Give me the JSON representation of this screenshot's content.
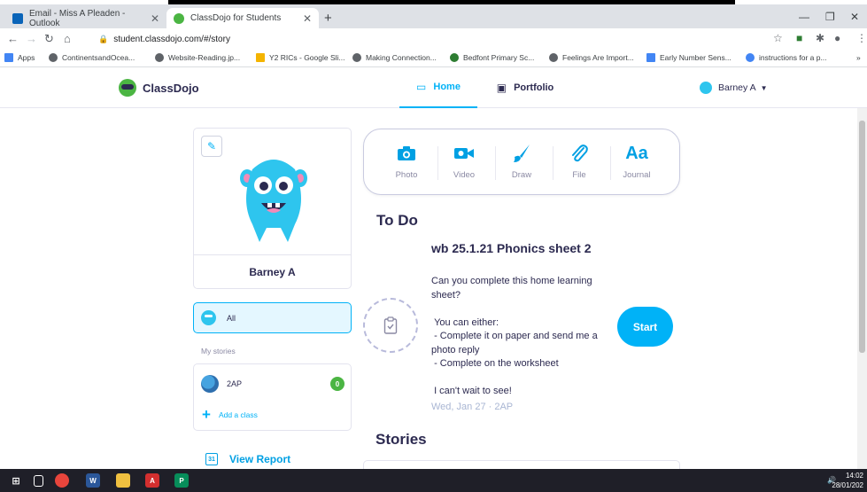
{
  "browser": {
    "tabs": [
      {
        "title": "Email - Miss A Pleaden - Outlook",
        "color": "#0a64b8"
      },
      {
        "title": "ClassDojo for Students",
        "color": "#4bb543"
      }
    ],
    "url": "student.classdojo.com/#/story",
    "bookmarks": [
      {
        "label": "Apps",
        "color": "#4285f4"
      },
      {
        "label": "ContinentsandOcea...",
        "color": "#5f6368"
      },
      {
        "label": "Website-Reading.jp...",
        "color": "#5f6368"
      },
      {
        "label": "Y2 RICs - Google Sli...",
        "color": "#f4b400"
      },
      {
        "label": "Making Connection...",
        "color": "#5f6368"
      },
      {
        "label": "Bedfont Primary Sc...",
        "color": "#2e7d32"
      },
      {
        "label": "Feelings Are Import...",
        "color": "#5f6368"
      },
      {
        "label": "Early Number Sens...",
        "color": "#4285f4"
      },
      {
        "label": "instructions for a p...",
        "color": "#4285f4"
      }
    ]
  },
  "app": {
    "brand": "ClassDojo",
    "nav": {
      "home": "Home",
      "portfolio": "Portfolio"
    },
    "user": "Barney A"
  },
  "profile": {
    "name": "Barney A"
  },
  "sidebar": {
    "all_label": "All",
    "my_stories_label": "My stories",
    "class_name": "2AP",
    "class_count": "0",
    "add_class": "Add a class",
    "view_report": "View Report",
    "view_report_day": "31"
  },
  "composer": {
    "photo": "Photo",
    "video": "Video",
    "draw": "Draw",
    "file": "File",
    "journal": "Journal",
    "journal_glyph": "Aa"
  },
  "todo": {
    "heading": "To Do",
    "title": "wb 25.1.21 Phonics sheet 2",
    "body": "Can you complete this home learning sheet?\n\n You can either:\n - Complete it on paper and send me a photo reply\n - Complete on the worksheet\n\n I can't wait to see!",
    "meta": "Wed, Jan 27  ·  2AP",
    "start": "Start"
  },
  "stories": {
    "heading": "Stories"
  },
  "taskbar": {
    "time": "14:02",
    "date": "28/01/202"
  },
  "colors": {
    "accent": "#00b2f7",
    "brand_green": "#4bb543",
    "text": "#2c2a50"
  }
}
